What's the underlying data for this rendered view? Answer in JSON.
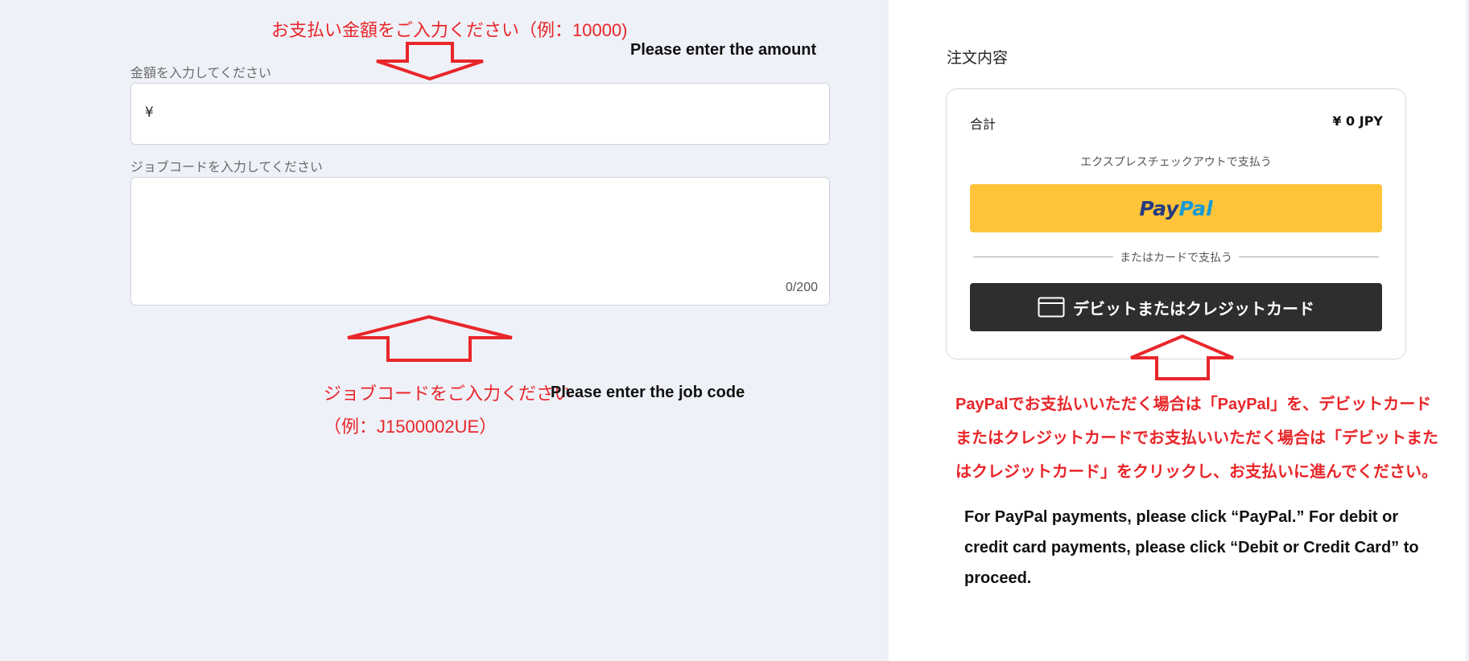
{
  "annotations": {
    "amount_jp": "お支払い金額をご入力ください（例：10000)",
    "amount_en": "Please enter the amount",
    "job_jp": "ジョブコードをご入力ください",
    "job_example": "（例：J1500002UE）",
    "job_en": "Please enter the job code",
    "payment_jp": "PayPalでお支払いいただく場合は「PayPal」を、デビットカードまたはクレジットカードでお支払いいただく場合は「デビットまたはクレジットカード」をクリックし、お支払いに進んでください。",
    "payment_en": "For PayPal payments, please click “PayPal.” For debit or credit card payments, please click “Debit or Credit Card” to proceed.",
    "annotation_color": "#e8262a"
  },
  "form": {
    "amount_label": "金額を入力してください",
    "currency_symbol": "¥",
    "amount_value": "",
    "job_label": "ジョブコードを入力してください",
    "job_value": "",
    "job_counter": "0/200"
  },
  "order": {
    "heading": "注文内容",
    "total_label": "合計",
    "total_amount": "¥ 0 JPY",
    "express_text": "エクスプレスチェックアウトで支払う",
    "paypal_pay": "Pay",
    "paypal_pal": "Pal",
    "divider_text": "またはカードで支払う",
    "card_button_label": "デビットまたはクレジットカード",
    "card_icon": "credit-card-icon"
  },
  "colors": {
    "background_left": "#eff1f8",
    "paypal_button": "#ffc439",
    "card_button": "#2c2e2f",
    "paypal_dark": "#253b80",
    "paypal_light": "#179bd7"
  }
}
